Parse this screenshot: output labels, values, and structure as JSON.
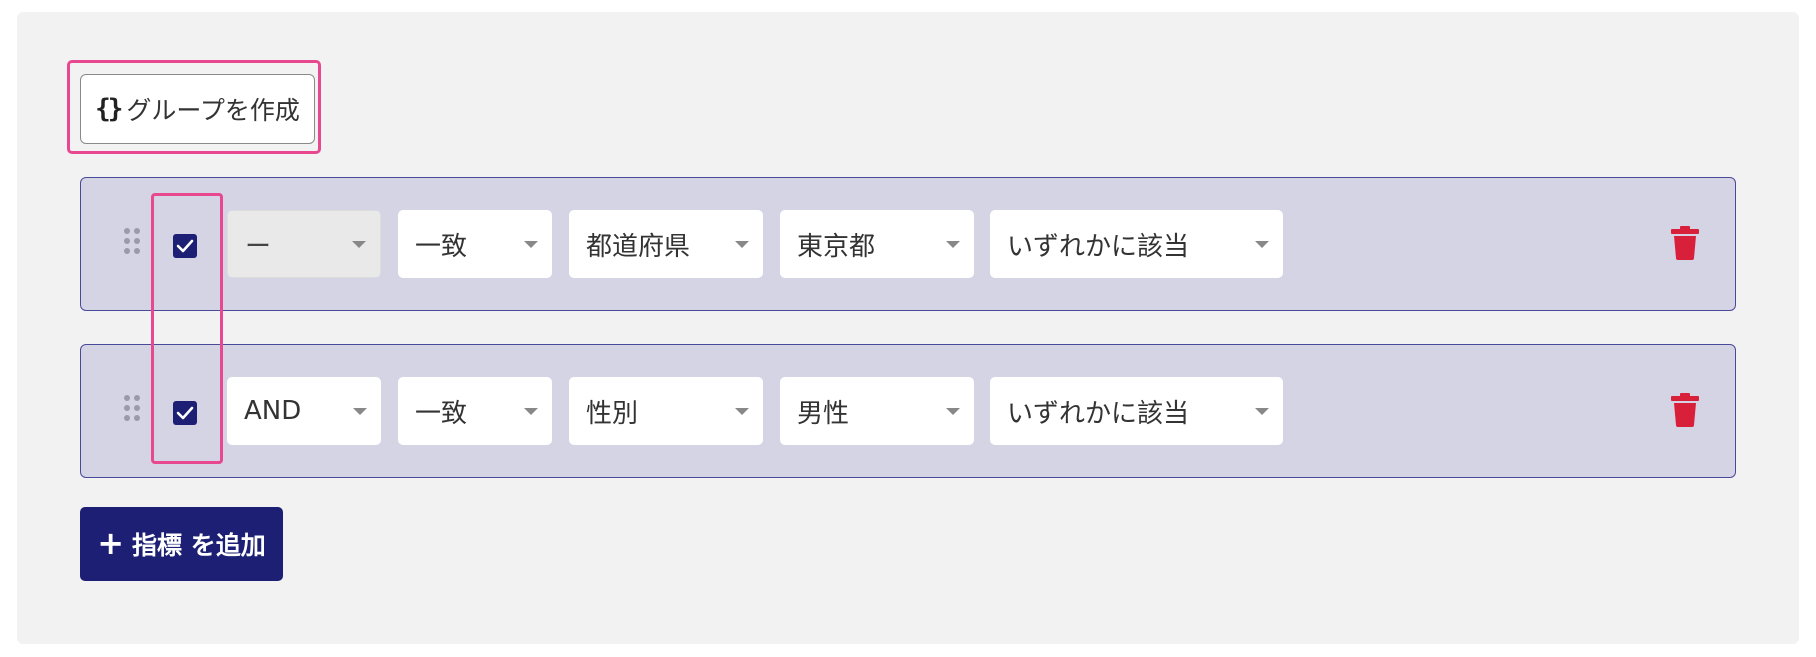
{
  "toolbar": {
    "create_group_icon": "braces-icon",
    "create_group_braces": "{}",
    "create_group_label": "グループを作成"
  },
  "conditions": [
    {
      "checked": true,
      "logic": "ー",
      "logic_disabled": true,
      "match": "一致",
      "field": "都道府県",
      "value": "東京都",
      "mode": "いずれかに該当"
    },
    {
      "checked": true,
      "logic": "AND",
      "logic_disabled": false,
      "match": "一致",
      "field": "性別",
      "value": "男性",
      "mode": "いずれかに該当"
    }
  ],
  "add_metric": {
    "plus": "+",
    "label": "指標 を追加"
  },
  "colors": {
    "primary": "#1c1f73",
    "row_background": "#d4d4e5",
    "row_border": "#4a4a9a",
    "delete": "#d9203a",
    "highlight": "#e8488f",
    "panel": "#f2f2f2"
  }
}
